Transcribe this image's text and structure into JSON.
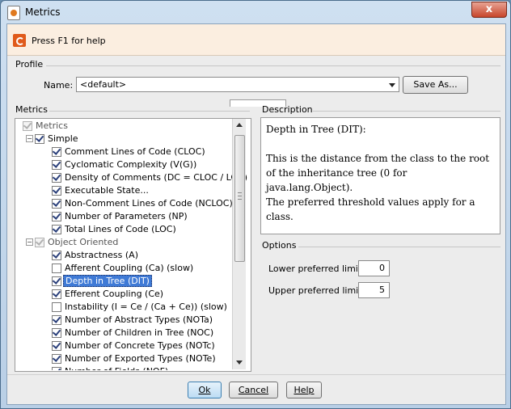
{
  "window": {
    "title": "Metrics",
    "close_label": "x"
  },
  "helpbar": {
    "text": "Press F1 for help"
  },
  "profile": {
    "group_label": "Profile",
    "name_label": "Name:",
    "name_value": "<default>",
    "save_as_label": "Save As..."
  },
  "metrics": {
    "group_label": "Metrics",
    "tree": [
      {
        "label": "Metrics",
        "level": 0,
        "expander": "",
        "state": "grey",
        "disabled": true
      },
      {
        "label": "Simple",
        "level": 1,
        "expander": "−",
        "state": "checked"
      },
      {
        "label": "Comment Lines of Code (CLOC)",
        "level": 2,
        "state": "checked"
      },
      {
        "label": "Cyclomatic Complexity (V(G))",
        "level": 2,
        "state": "checked"
      },
      {
        "label": "Density of Comments (DC = CLOC / LOC)",
        "level": 2,
        "state": "checked"
      },
      {
        "label": "Executable State...",
        "level": 2,
        "state": "checked"
      },
      {
        "label": "Non-Comment Lines of Code (NCLOC)",
        "level": 2,
        "state": "checked"
      },
      {
        "label": "Number of Parameters (NP)",
        "level": 2,
        "state": "checked"
      },
      {
        "label": "Total Lines of Code (LOC)",
        "level": 2,
        "state": "checked"
      },
      {
        "label": "Object Oriented",
        "level": 1,
        "expander": "−",
        "state": "grey",
        "disabled": true
      },
      {
        "label": "Abstractness (A)",
        "level": 2,
        "state": "checked"
      },
      {
        "label": "Afferent Coupling (Ca) (slow)",
        "level": 2,
        "state": "unchecked"
      },
      {
        "label": "Depth in Tree (DIT)",
        "level": 2,
        "state": "checked",
        "selected": true
      },
      {
        "label": "Efferent Coupling (Ce)",
        "level": 2,
        "state": "checked"
      },
      {
        "label": "Instability (I = Ce / (Ca + Ce)) (slow)",
        "level": 2,
        "state": "unchecked"
      },
      {
        "label": "Number of Abstract Types (NOTa)",
        "level": 2,
        "state": "checked"
      },
      {
        "label": "Number of Children in Tree (NOC)",
        "level": 2,
        "state": "checked"
      },
      {
        "label": "Number of Concrete Types (NOTc)",
        "level": 2,
        "state": "checked"
      },
      {
        "label": "Number of Exported Types (NOTe)",
        "level": 2,
        "state": "checked"
      },
      {
        "label": "Number of Fields (NOF)",
        "level": 2,
        "state": "checked"
      }
    ]
  },
  "description": {
    "group_label": "Description",
    "title": "Depth in Tree (DIT):",
    "body": "This is the distance from the class to the root of the inheritance tree (0 for java.lang.Object).",
    "note": "The preferred threshold values apply for a class."
  },
  "options": {
    "group_label": "Options",
    "lower_label": "Lower preferred limit:",
    "lower_value": "0",
    "upper_label": "Upper preferred limit:",
    "upper_value": "5"
  },
  "buttons": {
    "ok": "Ok",
    "cancel": "Cancel",
    "help": "Help"
  }
}
